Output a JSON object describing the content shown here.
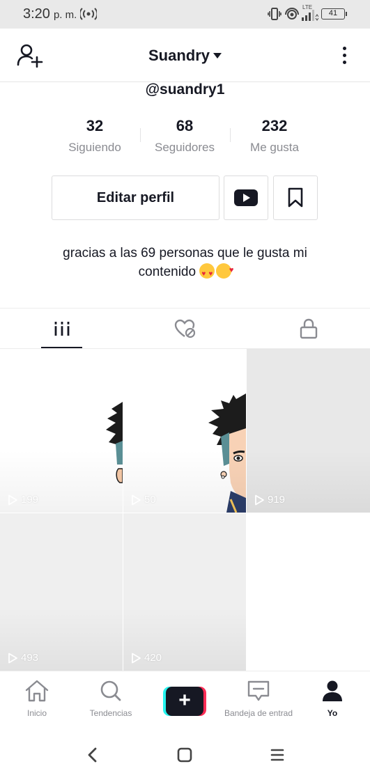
{
  "status_bar": {
    "time": "3:20",
    "ampm": "p. m.",
    "network": "LTE",
    "battery": "41"
  },
  "header": {
    "title": "Suandry"
  },
  "profile": {
    "username": "@suandry1",
    "stats": [
      {
        "value": "32",
        "label": "Siguiendo"
      },
      {
        "value": "68",
        "label": "Seguidores"
      },
      {
        "value": "232",
        "label": "Me gusta"
      }
    ],
    "edit_button": "Editar perfil",
    "bio_line1": "gracias a las 69 personas que le gusta mi",
    "bio_line2": "contenido"
  },
  "tabs": [
    {
      "icon": "grid-videos-icon",
      "active": true
    },
    {
      "icon": "liked-hidden-icon",
      "active": false
    },
    {
      "icon": "lock-icon",
      "active": false
    }
  ],
  "videos": [
    {
      "views": "199"
    },
    {
      "views": "50"
    },
    {
      "views": "919"
    },
    {
      "views": "493"
    },
    {
      "views": "420"
    }
  ],
  "bottom_nav": [
    {
      "label": "Inicio",
      "icon": "home-icon"
    },
    {
      "label": "Tendencias",
      "icon": "search-icon"
    },
    {
      "label": "",
      "icon": "plus-icon"
    },
    {
      "label": "Bandeja de entrad",
      "icon": "inbox-icon"
    },
    {
      "label": "Yo",
      "icon": "profile-icon",
      "active": true
    }
  ],
  "colors": {
    "accent_cyan": "#25f4ee",
    "accent_red": "#fe2c55",
    "text_dark": "#161823",
    "text_muted": "#8a8b91"
  }
}
